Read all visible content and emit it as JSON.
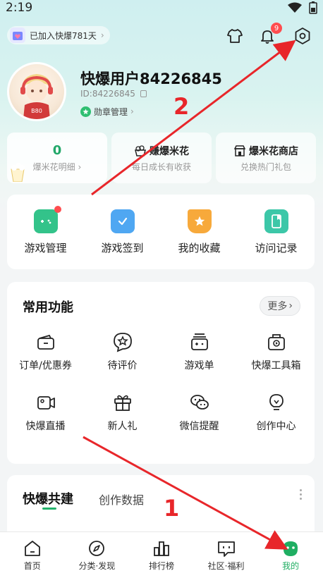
{
  "status_bar": {
    "time": "2:19"
  },
  "top_bar": {
    "joined_text": "已加入快爆781天",
    "notification_count": "9"
  },
  "profile": {
    "username": "快爆用户84226845",
    "user_id": "ID:84226845",
    "medal_label": "勋章管理"
  },
  "stats": [
    {
      "main": "0",
      "sub": "爆米花明细"
    },
    {
      "main": "赚爆米花",
      "sub": "每日成长有收获"
    },
    {
      "main": "爆米花商店",
      "sub": "兑换热门礼包"
    }
  ],
  "quick_actions": [
    {
      "label": "游戏管理",
      "icon": "gamepad-icon"
    },
    {
      "label": "游戏签到",
      "icon": "check-in-icon"
    },
    {
      "label": "我的收藏",
      "icon": "star-bookmark-icon"
    },
    {
      "label": "访问记录",
      "icon": "history-book-icon"
    }
  ],
  "common_functions": {
    "title": "常用功能",
    "more_label": "更多",
    "items": [
      {
        "label": "订单/优惠券",
        "icon": "wallet-icon"
      },
      {
        "label": "待评价",
        "icon": "review-star-icon"
      },
      {
        "label": "游戏单",
        "icon": "game-list-icon"
      },
      {
        "label": "快爆工具箱",
        "icon": "toolbox-icon"
      },
      {
        "label": "快爆直播",
        "icon": "video-camera-icon"
      },
      {
        "label": "新人礼",
        "icon": "gift-icon"
      },
      {
        "label": "微信提醒",
        "icon": "wechat-icon"
      },
      {
        "label": "创作中心",
        "icon": "lightbulb-icon"
      }
    ]
  },
  "build_section": {
    "tab_active": "快爆共建",
    "tab_other": "创作数据"
  },
  "annotations": {
    "label_1": "1",
    "label_2": "2",
    "arrow_color": "#e8262a"
  },
  "bottom_nav": [
    {
      "label": "首页",
      "icon": "home-icon"
    },
    {
      "label": "分类·发现",
      "icon": "compass-icon"
    },
    {
      "label": "排行榜",
      "icon": "ranking-icon"
    },
    {
      "label": "社区·福利",
      "icon": "community-icon"
    },
    {
      "label": "我的",
      "icon": "profile-icon",
      "active": true
    }
  ],
  "colors": {
    "accent_green": "#1fae62",
    "badge_red": "#ff4d4f"
  }
}
